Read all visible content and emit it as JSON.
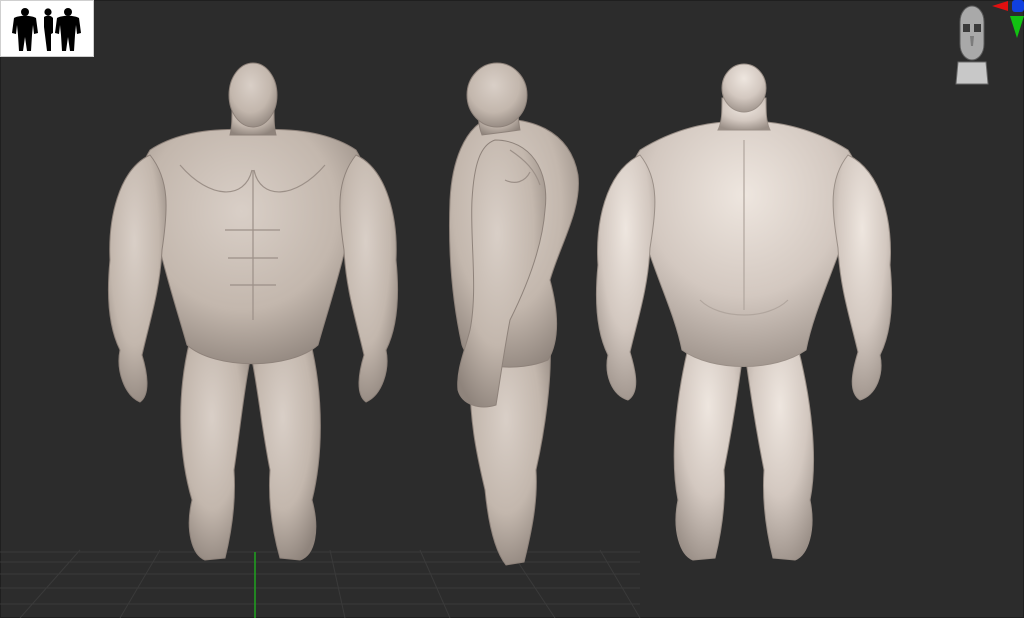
{
  "window": {
    "title": ""
  },
  "viewport": {
    "background": "#2c2c2c",
    "grid_color": "#3a3a3a",
    "axis_y_color": "#1ea31e",
    "model_color": "#c9bdb3",
    "model_shadow": "#8e827a"
  },
  "navigator": {
    "icon": "three-figure-silhouette-icon",
    "background": "#ffffff",
    "silhouette_color": "#000000"
  },
  "orientation_gizmo": {
    "icon": "head-orientation-icon",
    "x_axis_color": "#e01010",
    "y_axis_color": "#12c212",
    "z_axis_color": "#1040e0"
  },
  "views": [
    {
      "name": "front",
      "icon": "front-view-figure-icon"
    },
    {
      "name": "side",
      "icon": "side-view-figure-icon"
    },
    {
      "name": "back",
      "icon": "back-view-figure-icon"
    }
  ]
}
